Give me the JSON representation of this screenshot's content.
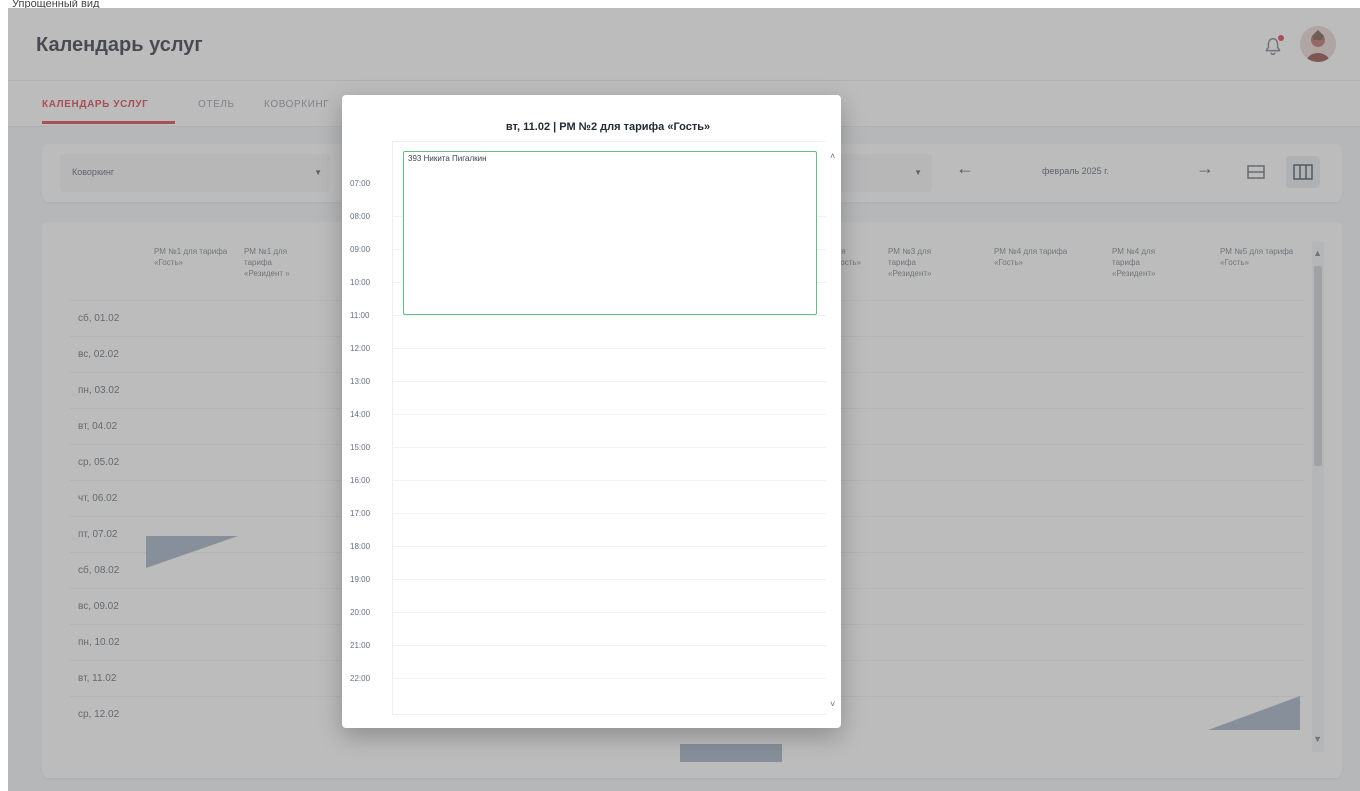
{
  "caption": "Упрощенный вид",
  "header": {
    "title": "Календарь услуг"
  },
  "tabs": [
    {
      "label": "КАЛЕНДАРЬ УСЛУГ",
      "active": true
    },
    {
      "label": "ОТЕЛЬ",
      "active": false
    },
    {
      "label": "КОВОРКИНГ",
      "active": false
    }
  ],
  "filters": {
    "service_type": "Коворкинг",
    "month": "февраль 2025 г."
  },
  "grid": {
    "columns": [
      "РМ №1 для тарифа «Гость»",
      "РМ №1 для тарифа «Резидент »",
      "",
      "",
      "",
      "",
      "для «Гость»",
      "РМ №3 для тарифа «Резидент»",
      "РМ №4 для тарифа «Гость»",
      "РМ №4 для тарифа «Резидент»",
      "РМ №5 для тарифа «Гость»"
    ],
    "rows": [
      "сб, 01.02",
      "вс, 02.02",
      "пн, 03.02",
      "вт, 04.02",
      "ср, 05.02",
      "чт, 06.02",
      "пт, 07.02",
      "сб, 08.02",
      "вс, 09.02",
      "пн, 10.02",
      "вт, 11.02",
      "ср, 12.02"
    ]
  },
  "modal": {
    "title": "вт, 11.02 | РМ №2 для тарифа «Гость»",
    "hours": [
      "07:00",
      "08:00",
      "09:00",
      "10:00",
      "11:00",
      "12:00",
      "13:00",
      "14:00",
      "15:00",
      "16:00",
      "17:00",
      "18:00",
      "19:00",
      "20:00",
      "21:00",
      "22:00"
    ],
    "event": {
      "text": "393 Никита Пигалкин"
    }
  },
  "colors": {
    "accent": "#d8303a",
    "event_border": "#5fbf84",
    "booking_fill": "#9aa9bf"
  }
}
